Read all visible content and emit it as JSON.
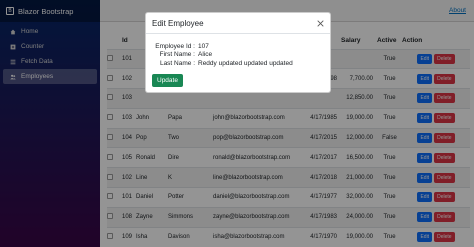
{
  "app": {
    "brand": "Blazor Bootstrap"
  },
  "sidebar": {
    "items": [
      {
        "label": "Home",
        "icon": "home-icon"
      },
      {
        "label": "Counter",
        "icon": "plus-square-icon"
      },
      {
        "label": "Fetch Data",
        "icon": "list-icon"
      },
      {
        "label": "Employees",
        "icon": "people-icon"
      }
    ]
  },
  "topbar": {
    "about": "About"
  },
  "table": {
    "headers": {
      "id": "Id",
      "doj": "DOJ",
      "salary": "Salary",
      "active": "Active",
      "action": "Action"
    },
    "rows": [
      {
        "id": "101",
        "first": "",
        "last": "",
        "email": "",
        "doj": "",
        "salary": "",
        "active": "True"
      },
      {
        "id": "102",
        "first": "",
        "last": "",
        "email": "",
        "doj": "11/17/1998",
        "salary": "7,700.00",
        "active": "True"
      },
      {
        "id": "103",
        "first": "",
        "last": "",
        "email": "",
        "doj": "",
        "salary": "12,850.00",
        "active": "True"
      },
      {
        "id": "103",
        "first": "John",
        "last": "Papa",
        "email": "john@blazorbootstrap.com",
        "doj": "4/17/1985",
        "salary": "19,000.00",
        "active": "True"
      },
      {
        "id": "104",
        "first": "Pop",
        "last": "Two",
        "email": "pop@blazorbootstrap.com",
        "doj": "4/17/2015",
        "salary": "12,000.00",
        "active": "False"
      },
      {
        "id": "105",
        "first": "Ronald",
        "last": "Dire",
        "email": "ronald@blazorbootstrap.com",
        "doj": "4/17/2017",
        "salary": "16,500.00",
        "active": "True"
      },
      {
        "id": "102",
        "first": "Line",
        "last": "K",
        "email": "line@blazorbootstrap.com",
        "doj": "4/17/2018",
        "salary": "21,000.00",
        "active": "True"
      },
      {
        "id": "101",
        "first": "Daniel",
        "last": "Potter",
        "email": "daniel@blazorbootstrap.com",
        "doj": "4/17/1977",
        "salary": "32,000.00",
        "active": "True"
      },
      {
        "id": "108",
        "first": "Zayne",
        "last": "Simmons",
        "email": "zayne@blazorbootstrap.com",
        "doj": "4/17/1983",
        "salary": "24,000.00",
        "active": "True"
      },
      {
        "id": "109",
        "first": "Isha",
        "last": "Davison",
        "email": "isha@blazorbootstrap.com",
        "doj": "4/17/1970",
        "salary": "19,000.00",
        "active": "True"
      }
    ],
    "edit_label": "Edit",
    "delete_label": "Delete"
  },
  "modal": {
    "title": "Edit Employee",
    "fields": [
      {
        "label": "Employee Id :",
        "value": "107"
      },
      {
        "label": "First Name :",
        "value": "Alice"
      },
      {
        "label": "Last Name :",
        "value": "Reddy updated updated updated"
      }
    ],
    "update_label": "Update"
  },
  "colors": {
    "edit": "#0d6efd",
    "delete": "#dc3545",
    "update": "#198754",
    "link": "#0071c1"
  }
}
